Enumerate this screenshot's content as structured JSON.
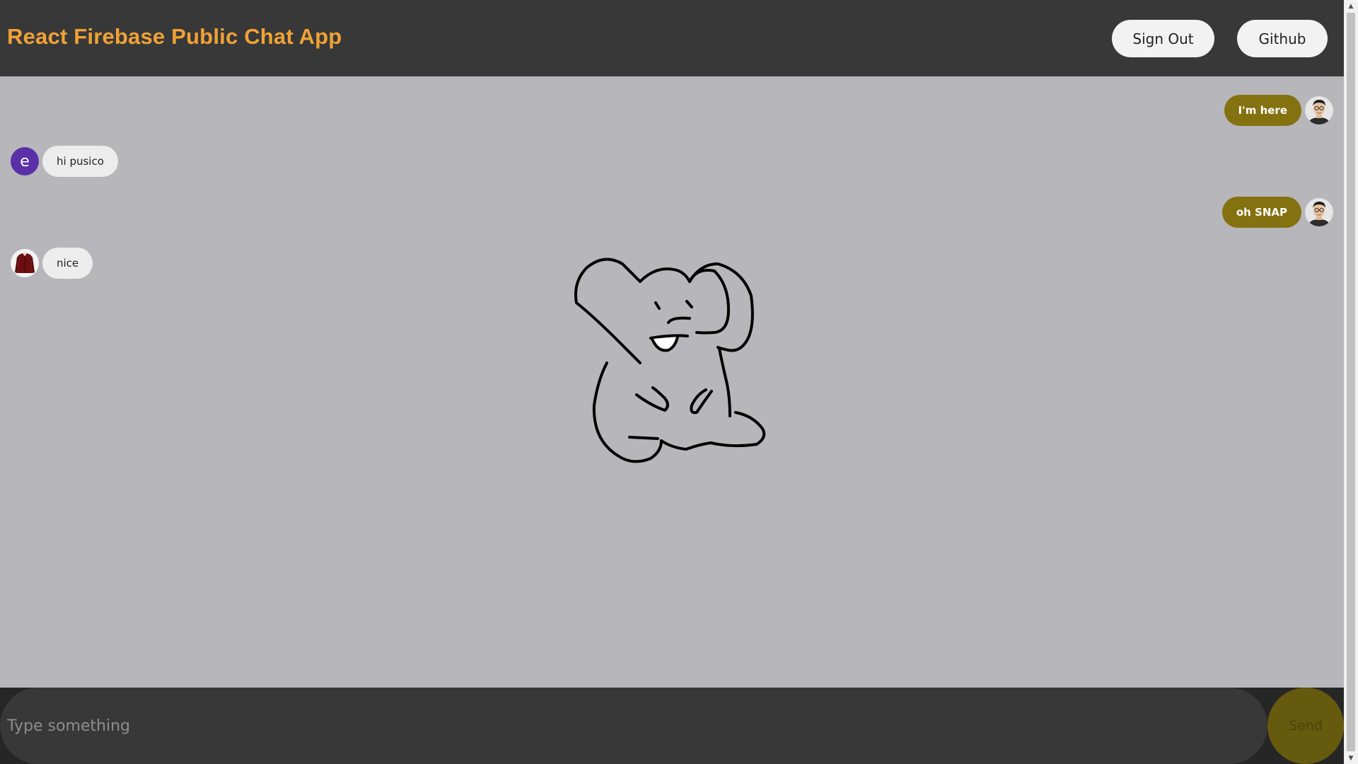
{
  "header": {
    "title": "React Firebase Public Chat App",
    "sign_out_label": "Sign Out",
    "github_label": "Github"
  },
  "messages": [
    {
      "direction": "sent",
      "text": "I'm here",
      "avatar": "user-photo"
    },
    {
      "direction": "received",
      "text": "hi pusico",
      "avatar_letter": "e"
    },
    {
      "direction": "sent",
      "text": "oh SNAP",
      "avatar": "user-photo"
    },
    {
      "direction": "received",
      "text": "nice",
      "avatar": "jacket-photo"
    }
  ],
  "composer": {
    "placeholder": "Type something",
    "send_label": "Send"
  },
  "colors": {
    "accent_title": "#f0a236",
    "sent_bubble": "#847110",
    "received_bubble": "#ededee",
    "header_bg": "#383838",
    "chat_bg": "#b7b7bb",
    "letter_avatar": "#5a2fa8"
  },
  "scrollbar": {
    "up_icon": "▲",
    "down_icon": "▼"
  }
}
